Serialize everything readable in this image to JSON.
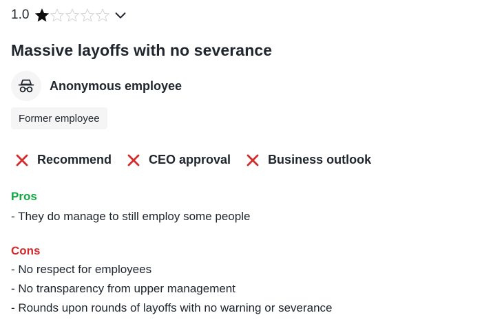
{
  "review": {
    "rating_value": "1.0",
    "rating": 1,
    "rating_max": 5,
    "star_color_filled": "#0d0d0d",
    "star_color_empty": "#d0d0d0",
    "title": "Massive layoffs with no severance",
    "author": {
      "name": "Anonymous employee",
      "avatar_icon": "anonymous-incognito-icon"
    },
    "employment_status": "Former employee",
    "indicators": [
      {
        "label": "Recommend",
        "status": "negative",
        "icon": "x-mark-icon"
      },
      {
        "label": "CEO approval",
        "status": "negative",
        "icon": "x-mark-icon"
      },
      {
        "label": "Business outlook",
        "status": "negative",
        "icon": "x-mark-icon"
      }
    ],
    "negative_color": "#d22b2b",
    "pros": {
      "heading": "Pros",
      "color": "#0caa41",
      "lines": [
        "- They do manage to still employ some people"
      ]
    },
    "cons": {
      "heading": "Cons",
      "color": "#d22b2b",
      "lines": [
        "- No respect for employees",
        "- No transparency from upper management",
        "- Rounds upon rounds of layoffs with no warning or severance"
      ]
    }
  }
}
